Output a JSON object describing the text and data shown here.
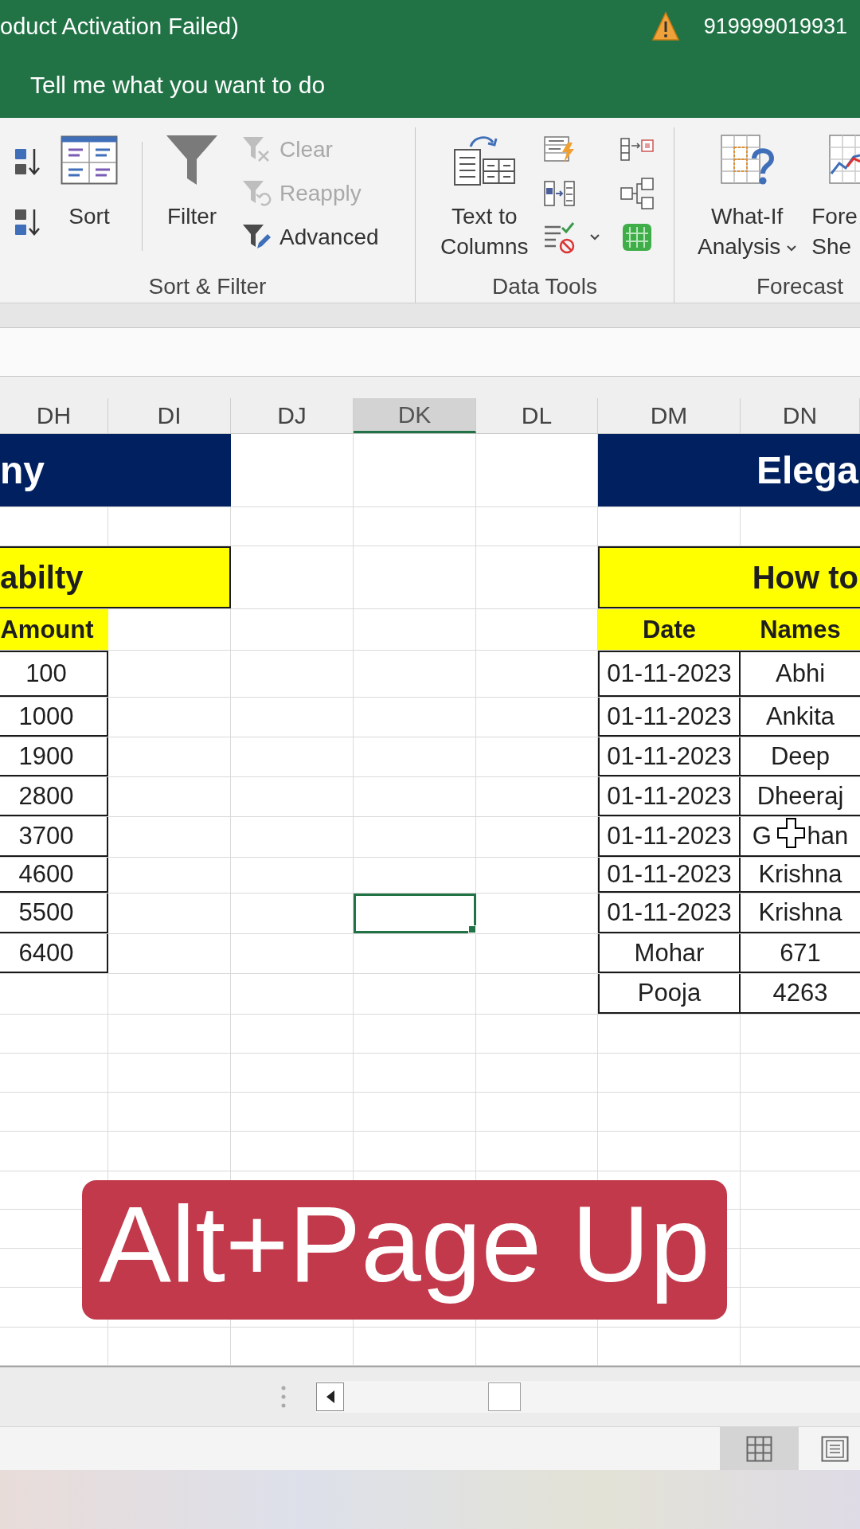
{
  "title_bar": {
    "title": "oduct Activation Failed)",
    "account": "919999019931",
    "tell_me": "Tell me what you want to do"
  },
  "ribbon": {
    "sort_filter": {
      "label": "Sort & Filter",
      "sort": "Sort",
      "filter": "Filter",
      "filter_actions": [
        {
          "label": "Clear",
          "disabled": true
        },
        {
          "label": "Reapply",
          "disabled": true
        },
        {
          "label": "Advanced",
          "disabled": false
        }
      ]
    },
    "data_tools": {
      "label": "Data Tools",
      "text_to_columns": [
        "Text to",
        "Columns"
      ]
    },
    "forecast": {
      "label": "Forecast",
      "what_if": [
        "What-If",
        "Analysis"
      ],
      "forecast_sheet": [
        "Fore",
        "She"
      ]
    }
  },
  "sheet": {
    "columns": [
      {
        "label": "DH",
        "selected": false
      },
      {
        "label": "DI",
        "selected": false
      },
      {
        "label": "DJ",
        "selected": false
      },
      {
        "label": "DK",
        "selected": true
      },
      {
        "label": "DL",
        "selected": false
      },
      {
        "label": "DM",
        "selected": false
      },
      {
        "label": "DN",
        "selected": false
      }
    ],
    "rows": [
      {
        "selected": false
      },
      {
        "selected": false
      },
      {
        "selected": false
      },
      {
        "selected": false
      },
      {
        "selected": false
      },
      {
        "selected": false
      },
      {
        "selected": false
      },
      {
        "selected": false
      },
      {
        "selected": false
      },
      {
        "selected": false
      },
      {
        "selected": true
      },
      {
        "selected": false
      },
      {
        "selected": false
      },
      {
        "selected": false
      },
      {
        "selected": false
      },
      {
        "selected": false
      },
      {
        "selected": false
      },
      {
        "selected": false
      },
      {
        "selected": false
      },
      {
        "selected": false
      },
      {
        "selected": false
      },
      {
        "selected": false
      }
    ],
    "left_table": {
      "title": "ny",
      "subtitle": "abilty",
      "header": "Amount",
      "values": [
        "100",
        "1000",
        "1900",
        "2800",
        "3700",
        "4600",
        "5500",
        "6400"
      ]
    },
    "right_table": {
      "title": "Elega",
      "subtitle": "How to",
      "headers": [
        "Date",
        "Names"
      ],
      "rows": [
        [
          "01-11-2023",
          "Abhi"
        ],
        [
          "01-11-2023",
          "Ankita"
        ],
        [
          "01-11-2023",
          "Deep"
        ],
        [
          "01-11-2023",
          "Dheeraj"
        ],
        [
          "01-11-2023",
          "G han"
        ],
        [
          "01-11-2023",
          "Krishna"
        ],
        [
          "01-11-2023",
          "Krishna"
        ],
        [
          "Mohar",
          "671"
        ],
        [
          "Pooja",
          "4263"
        ]
      ]
    }
  },
  "caption": "Alt+Page Up",
  "status_bar": {
    "views": [
      {
        "selected": true
      },
      {
        "selected": false
      }
    ]
  }
}
